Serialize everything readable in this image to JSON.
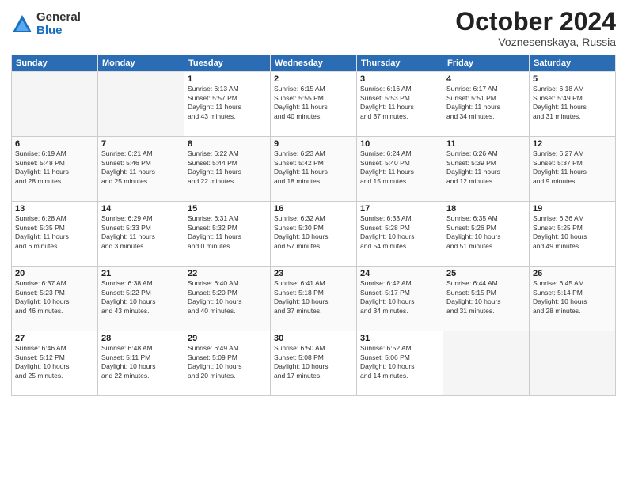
{
  "header": {
    "logo_general": "General",
    "logo_blue": "Blue",
    "month_title": "October 2024",
    "location": "Voznesenskaya, Russia"
  },
  "weekdays": [
    "Sunday",
    "Monday",
    "Tuesday",
    "Wednesday",
    "Thursday",
    "Friday",
    "Saturday"
  ],
  "weeks": [
    [
      {
        "day": "",
        "info": ""
      },
      {
        "day": "",
        "info": ""
      },
      {
        "day": "1",
        "info": "Sunrise: 6:13 AM\nSunset: 5:57 PM\nDaylight: 11 hours\nand 43 minutes."
      },
      {
        "day": "2",
        "info": "Sunrise: 6:15 AM\nSunset: 5:55 PM\nDaylight: 11 hours\nand 40 minutes."
      },
      {
        "day": "3",
        "info": "Sunrise: 6:16 AM\nSunset: 5:53 PM\nDaylight: 11 hours\nand 37 minutes."
      },
      {
        "day": "4",
        "info": "Sunrise: 6:17 AM\nSunset: 5:51 PM\nDaylight: 11 hours\nand 34 minutes."
      },
      {
        "day": "5",
        "info": "Sunrise: 6:18 AM\nSunset: 5:49 PM\nDaylight: 11 hours\nand 31 minutes."
      }
    ],
    [
      {
        "day": "6",
        "info": "Sunrise: 6:19 AM\nSunset: 5:48 PM\nDaylight: 11 hours\nand 28 minutes."
      },
      {
        "day": "7",
        "info": "Sunrise: 6:21 AM\nSunset: 5:46 PM\nDaylight: 11 hours\nand 25 minutes."
      },
      {
        "day": "8",
        "info": "Sunrise: 6:22 AM\nSunset: 5:44 PM\nDaylight: 11 hours\nand 22 minutes."
      },
      {
        "day": "9",
        "info": "Sunrise: 6:23 AM\nSunset: 5:42 PM\nDaylight: 11 hours\nand 18 minutes."
      },
      {
        "day": "10",
        "info": "Sunrise: 6:24 AM\nSunset: 5:40 PM\nDaylight: 11 hours\nand 15 minutes."
      },
      {
        "day": "11",
        "info": "Sunrise: 6:26 AM\nSunset: 5:39 PM\nDaylight: 11 hours\nand 12 minutes."
      },
      {
        "day": "12",
        "info": "Sunrise: 6:27 AM\nSunset: 5:37 PM\nDaylight: 11 hours\nand 9 minutes."
      }
    ],
    [
      {
        "day": "13",
        "info": "Sunrise: 6:28 AM\nSunset: 5:35 PM\nDaylight: 11 hours\nand 6 minutes."
      },
      {
        "day": "14",
        "info": "Sunrise: 6:29 AM\nSunset: 5:33 PM\nDaylight: 11 hours\nand 3 minutes."
      },
      {
        "day": "15",
        "info": "Sunrise: 6:31 AM\nSunset: 5:32 PM\nDaylight: 11 hours\nand 0 minutes."
      },
      {
        "day": "16",
        "info": "Sunrise: 6:32 AM\nSunset: 5:30 PM\nDaylight: 10 hours\nand 57 minutes."
      },
      {
        "day": "17",
        "info": "Sunrise: 6:33 AM\nSunset: 5:28 PM\nDaylight: 10 hours\nand 54 minutes."
      },
      {
        "day": "18",
        "info": "Sunrise: 6:35 AM\nSunset: 5:26 PM\nDaylight: 10 hours\nand 51 minutes."
      },
      {
        "day": "19",
        "info": "Sunrise: 6:36 AM\nSunset: 5:25 PM\nDaylight: 10 hours\nand 49 minutes."
      }
    ],
    [
      {
        "day": "20",
        "info": "Sunrise: 6:37 AM\nSunset: 5:23 PM\nDaylight: 10 hours\nand 46 minutes."
      },
      {
        "day": "21",
        "info": "Sunrise: 6:38 AM\nSunset: 5:22 PM\nDaylight: 10 hours\nand 43 minutes."
      },
      {
        "day": "22",
        "info": "Sunrise: 6:40 AM\nSunset: 5:20 PM\nDaylight: 10 hours\nand 40 minutes."
      },
      {
        "day": "23",
        "info": "Sunrise: 6:41 AM\nSunset: 5:18 PM\nDaylight: 10 hours\nand 37 minutes."
      },
      {
        "day": "24",
        "info": "Sunrise: 6:42 AM\nSunset: 5:17 PM\nDaylight: 10 hours\nand 34 minutes."
      },
      {
        "day": "25",
        "info": "Sunrise: 6:44 AM\nSunset: 5:15 PM\nDaylight: 10 hours\nand 31 minutes."
      },
      {
        "day": "26",
        "info": "Sunrise: 6:45 AM\nSunset: 5:14 PM\nDaylight: 10 hours\nand 28 minutes."
      }
    ],
    [
      {
        "day": "27",
        "info": "Sunrise: 6:46 AM\nSunset: 5:12 PM\nDaylight: 10 hours\nand 25 minutes."
      },
      {
        "day": "28",
        "info": "Sunrise: 6:48 AM\nSunset: 5:11 PM\nDaylight: 10 hours\nand 22 minutes."
      },
      {
        "day": "29",
        "info": "Sunrise: 6:49 AM\nSunset: 5:09 PM\nDaylight: 10 hours\nand 20 minutes."
      },
      {
        "day": "30",
        "info": "Sunrise: 6:50 AM\nSunset: 5:08 PM\nDaylight: 10 hours\nand 17 minutes."
      },
      {
        "day": "31",
        "info": "Sunrise: 6:52 AM\nSunset: 5:06 PM\nDaylight: 10 hours\nand 14 minutes."
      },
      {
        "day": "",
        "info": ""
      },
      {
        "day": "",
        "info": ""
      }
    ]
  ]
}
